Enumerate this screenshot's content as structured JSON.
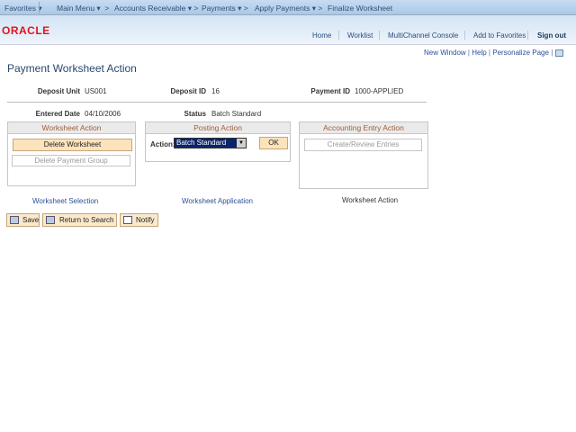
{
  "nav": {
    "favorites": "Favorites",
    "breadcrumbs": [
      "Main Menu",
      "Accounts Receivable",
      "Payments",
      "Apply Payments",
      "Finalize Worksheet"
    ]
  },
  "header": {
    "links": [
      "Home",
      "Worklist",
      "MultiChannel Console",
      "Add to Favorites"
    ],
    "signout": "Sign out",
    "logo": "ORACLE"
  },
  "pagebar": {
    "new_window": "New Window",
    "help": "Help",
    "personalize": "Personalize Page"
  },
  "page": {
    "title": "Payment Worksheet Action"
  },
  "fields": {
    "deposit_unit_label": "Deposit Unit",
    "deposit_unit": "US001",
    "deposit_id_label": "Deposit ID",
    "deposit_id": "16",
    "payment_id_label": "Payment ID",
    "payment_id": "1000-APPLIED",
    "entered_date_label": "Entered Date",
    "entered_date": "04/10/2006",
    "status_label": "Status",
    "status": "Batch Standard"
  },
  "worksheet_action": {
    "title": "Worksheet Action",
    "delete_worksheet": "Delete Worksheet",
    "delete_payment_group": "Delete Payment Group"
  },
  "posting_action": {
    "title": "Posting Action",
    "action_label": "Action:",
    "action_value": "Batch Standard",
    "ok": "OK"
  },
  "accounting": {
    "title": "Accounting Entry Action",
    "create_review": "Create/Review Entries"
  },
  "links": {
    "selection": "Worksheet Selection",
    "application": "Worksheet Application",
    "action": "Worksheet Action"
  },
  "toolbar": {
    "save": "Save",
    "return": "Return to Search",
    "notify": "Notify"
  }
}
